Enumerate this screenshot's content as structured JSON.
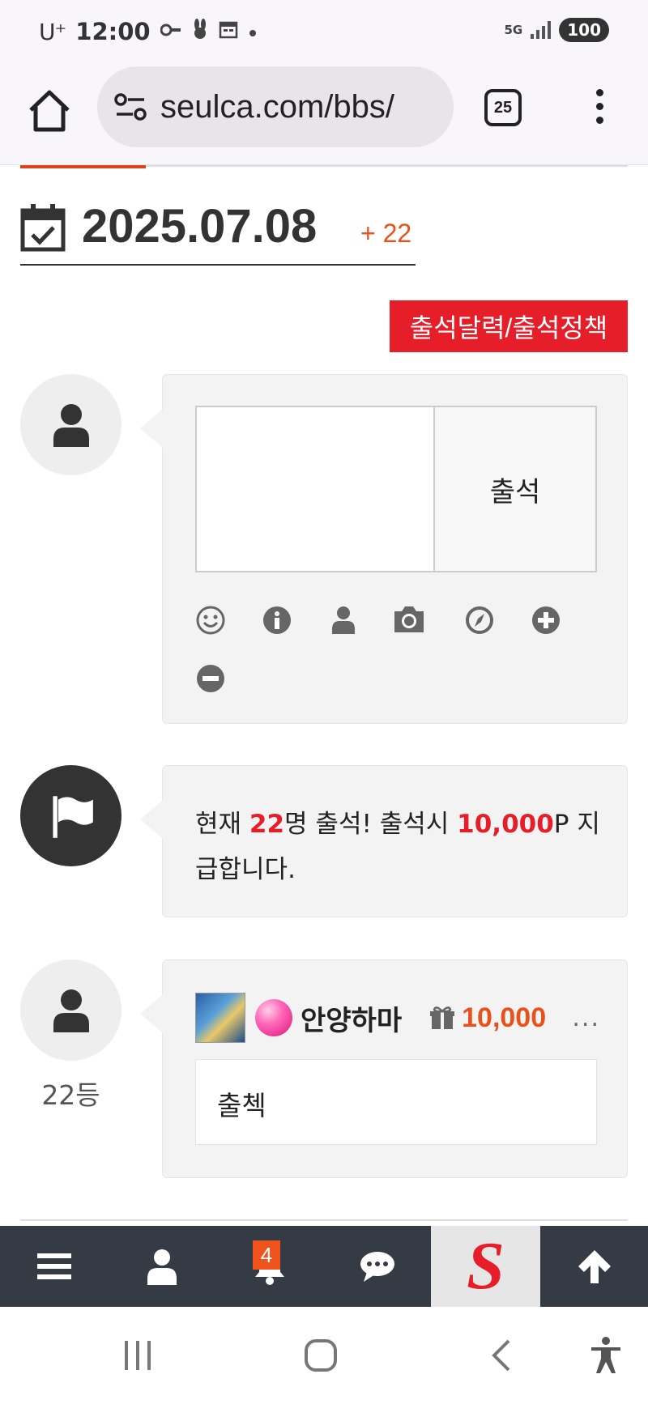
{
  "status_bar": {
    "carrier": "U⁺",
    "time": "12:00",
    "network": "5G",
    "battery": "100",
    "icons": [
      "key-icon",
      "rabbit-icon",
      "calendar-icon",
      "dot-icon"
    ]
  },
  "browser": {
    "url": "seulca.com/bbs/",
    "tab_count": "25",
    "icons": [
      "home-icon",
      "site-settings-icon",
      "tabs-icon",
      "more-vert-icon"
    ]
  },
  "attendance": {
    "date": "2025.07.08",
    "count_badge": "+ 22",
    "policy_button": "출석달력/출석정책"
  },
  "comment_form": {
    "submit_label": "출석",
    "comment_value": "",
    "tools": [
      "emoji-icon",
      "info-icon",
      "user-icon",
      "camera-icon",
      "compass-icon",
      "plus-circle-icon",
      "minus-circle-icon"
    ]
  },
  "notice": {
    "prefix": "현재 ",
    "count": "22",
    "middle": "명 출석! 출석시 ",
    "points": "10,000",
    "suffix": "P 지급합니다."
  },
  "entries": [
    {
      "rank": "22등",
      "username": "안양하마",
      "points": "10,000",
      "more": "...",
      "message": "출첵"
    }
  ],
  "bottom_nav": {
    "notification_count": "4",
    "logo_letter": "S",
    "items": [
      "menu-icon",
      "user-icon",
      "bell-icon",
      "chat-icon",
      "logo",
      "arrow-up-icon"
    ]
  },
  "colors": {
    "accent": "#e61e2a",
    "orange": "#e8501c",
    "nav_bg": "#343b45"
  }
}
